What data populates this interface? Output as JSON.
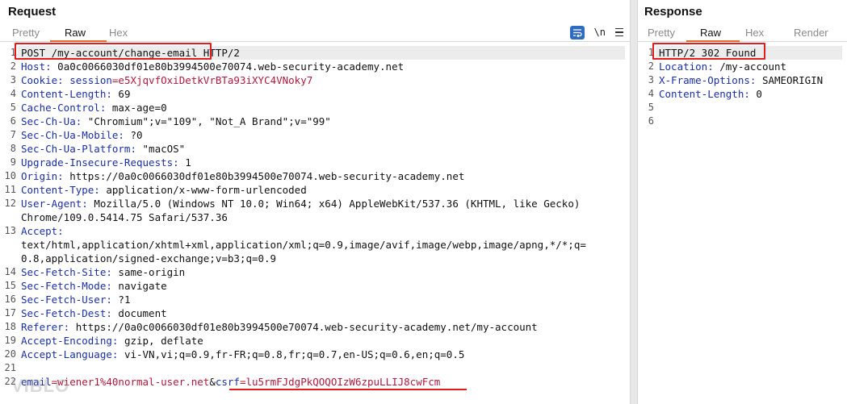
{
  "request": {
    "title": "Request",
    "tabs": [
      "Pretty",
      "Raw",
      "Hex"
    ],
    "active_tab": "Raw",
    "icons": [
      "wrap-lines-icon",
      "newline-toggle-icon",
      "menu-icon"
    ],
    "icon_text": {
      "newline": "\\n"
    },
    "lines": [
      {
        "num": "1",
        "parts": [
          {
            "t": "POST /my-account/change-email",
            "c": "v"
          },
          {
            "t": " HTTP/2",
            "c": "v"
          }
        ]
      },
      {
        "num": "2",
        "parts": [
          {
            "t": "Host:",
            "c": "k"
          },
          {
            "t": " 0a0c0066030df01e80b3994500e70074.web-security-academy.net",
            "c": "v"
          }
        ]
      },
      {
        "num": "3",
        "parts": [
          {
            "t": "Cookie:",
            "c": "k"
          },
          {
            "t": " ",
            "c": "v"
          },
          {
            "t": "session",
            "c": "k"
          },
          {
            "t": "=e5XjqvfOxiDetkVrBTa93iXYC4VNoky7",
            "c": "cv"
          }
        ]
      },
      {
        "num": "4",
        "parts": [
          {
            "t": "Content-Length:",
            "c": "k"
          },
          {
            "t": " 69",
            "c": "v"
          }
        ]
      },
      {
        "num": "5",
        "parts": [
          {
            "t": "Cache-Control:",
            "c": "k"
          },
          {
            "t": " max-age=0",
            "c": "v"
          }
        ]
      },
      {
        "num": "6",
        "parts": [
          {
            "t": "Sec-Ch-Ua:",
            "c": "k"
          },
          {
            "t": " \"Chromium\";v=\"109\", \"Not_A Brand\";v=\"99\"",
            "c": "v"
          }
        ]
      },
      {
        "num": "7",
        "parts": [
          {
            "t": "Sec-Ch-Ua-Mobile:",
            "c": "k"
          },
          {
            "t": " ?0",
            "c": "v"
          }
        ]
      },
      {
        "num": "8",
        "parts": [
          {
            "t": "Sec-Ch-Ua-Platform:",
            "c": "k"
          },
          {
            "t": " \"macOS\"",
            "c": "v"
          }
        ]
      },
      {
        "num": "9",
        "parts": [
          {
            "t": "Upgrade-Insecure-Requests:",
            "c": "k"
          },
          {
            "t": " 1",
            "c": "v"
          }
        ]
      },
      {
        "num": "10",
        "parts": [
          {
            "t": "Origin:",
            "c": "k"
          },
          {
            "t": " https://0a0c0066030df01e80b3994500e70074.web-security-academy.net",
            "c": "v"
          }
        ]
      },
      {
        "num": "11",
        "parts": [
          {
            "t": "Content-Type:",
            "c": "k"
          },
          {
            "t": " application/x-www-form-urlencoded",
            "c": "v"
          }
        ]
      },
      {
        "num": "12",
        "parts": [
          {
            "t": "User-Agent:",
            "c": "k"
          },
          {
            "t": " Mozilla/5.0 (Windows NT 10.0; Win64; x64) AppleWebKit/537.36 (KHTML, like Gecko)",
            "c": "v"
          }
        ]
      },
      {
        "num": "",
        "parts": [
          {
            "t": "Chrome/109.0.5414.75 Safari/537.36",
            "c": "v"
          }
        ]
      },
      {
        "num": "13",
        "parts": [
          {
            "t": "Accept:",
            "c": "k"
          }
        ]
      },
      {
        "num": "",
        "parts": [
          {
            "t": "text/html,application/xhtml+xml,application/xml;q=0.9,image/avif,image/webp,image/apng,*/*;q=",
            "c": "v"
          }
        ]
      },
      {
        "num": "",
        "parts": [
          {
            "t": "0.8,application/signed-exchange;v=b3;q=0.9",
            "c": "v"
          }
        ]
      },
      {
        "num": "14",
        "parts": [
          {
            "t": "Sec-Fetch-Site:",
            "c": "k"
          },
          {
            "t": " same-origin",
            "c": "v"
          }
        ]
      },
      {
        "num": "15",
        "parts": [
          {
            "t": "Sec-Fetch-Mode:",
            "c": "k"
          },
          {
            "t": " navigate",
            "c": "v"
          }
        ]
      },
      {
        "num": "16",
        "parts": [
          {
            "t": "Sec-Fetch-User:",
            "c": "k"
          },
          {
            "t": " ?1",
            "c": "v"
          }
        ]
      },
      {
        "num": "17",
        "parts": [
          {
            "t": "Sec-Fetch-Dest:",
            "c": "k"
          },
          {
            "t": " document",
            "c": "v"
          }
        ]
      },
      {
        "num": "18",
        "parts": [
          {
            "t": "Referer:",
            "c": "k"
          },
          {
            "t": " https://0a0c0066030df01e80b3994500e70074.web-security-academy.net/my-account",
            "c": "v"
          }
        ]
      },
      {
        "num": "19",
        "parts": [
          {
            "t": "Accept-Encoding:",
            "c": "k"
          },
          {
            "t": " gzip, deflate",
            "c": "v"
          }
        ]
      },
      {
        "num": "20",
        "parts": [
          {
            "t": "Accept-Language:",
            "c": "k"
          },
          {
            "t": " vi-VN,vi;q=0.9,fr-FR;q=0.8,fr;q=0.7,en-US;q=0.6,en;q=0.5",
            "c": "v"
          }
        ]
      },
      {
        "num": "21",
        "parts": []
      },
      {
        "num": "22",
        "parts": [
          {
            "t": "email",
            "c": "pk"
          },
          {
            "t": "=wiener1%40normal-user.net",
            "c": "pv"
          },
          {
            "t": "&",
            "c": "amp"
          },
          {
            "t": "csrf",
            "c": "pk"
          },
          {
            "t": "=lu5rmFJdgPkQOQOIzW6zpuLLIJ8cwFcm",
            "c": "pv"
          }
        ]
      }
    ]
  },
  "response": {
    "title": "Response",
    "tabs": [
      "Pretty",
      "Raw",
      "Hex",
      "Render"
    ],
    "active_tab": "Raw",
    "lines": [
      {
        "num": "1",
        "parts": [
          {
            "t": "HTTP/2 302 Found",
            "c": "v"
          }
        ]
      },
      {
        "num": "2",
        "parts": [
          {
            "t": "Location:",
            "c": "k"
          },
          {
            "t": " /my-account",
            "c": "v"
          }
        ]
      },
      {
        "num": "3",
        "parts": [
          {
            "t": "X-Frame-Options:",
            "c": "k"
          },
          {
            "t": " SAMEORIGIN",
            "c": "v"
          }
        ]
      },
      {
        "num": "4",
        "parts": [
          {
            "t": "Content-Length:",
            "c": "k"
          },
          {
            "t": " 0",
            "c": "v"
          }
        ]
      },
      {
        "num": "5",
        "parts": []
      },
      {
        "num": "6",
        "parts": []
      }
    ]
  },
  "watermark": "VIBLO",
  "colors": {
    "header_key": "#1a2fa6",
    "cookie_value": "#b0193c",
    "highlight_box": "#e21d1d",
    "active_tab_underline": "#e4662a",
    "wrap_icon": "#2f6bbf"
  }
}
